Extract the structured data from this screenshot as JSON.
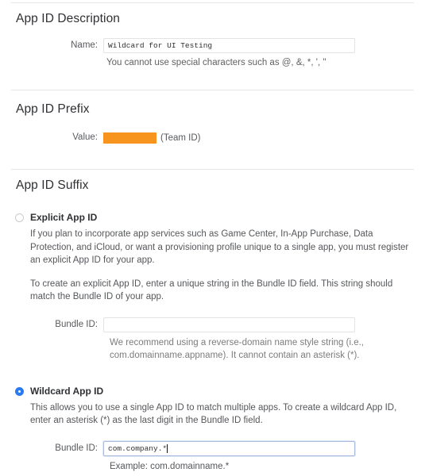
{
  "sections": {
    "description": {
      "title": "App ID Description",
      "name_label": "Name:",
      "name_value": "Wildcard for UI Testing",
      "name_hint": "You cannot use special characters such as @, &, *, ', \""
    },
    "prefix": {
      "title": "App ID Prefix",
      "value_label": "Value:",
      "redacted_value": "",
      "team_id_note": "(Team ID)",
      "redaction_color": "#f7941d"
    },
    "suffix": {
      "title": "App ID Suffix",
      "explicit": {
        "option_label": "Explicit App ID",
        "selected": false,
        "paragraph_1": "If you plan to incorporate app services such as Game Center, In-App Purchase, Data Protection, and iCloud, or want a provisioning profile unique to a single app, you must register an explicit App ID for your app.",
        "paragraph_2": "To create an explicit App ID, enter a unique string in the Bundle ID field. This string should match the Bundle ID of your app.",
        "bundle_label": "Bundle ID:",
        "bundle_value": "",
        "bundle_hint": "We recommend using a reverse-domain name style string (i.e., com.domainname.appname). It cannot contain an asterisk (*)."
      },
      "wildcard": {
        "option_label": "Wildcard App ID",
        "selected": true,
        "paragraph_1": "This allows you to use a single App ID to match multiple apps. To create a wildcard App ID, enter an asterisk (*) as the last digit in the Bundle ID field.",
        "bundle_label": "Bundle ID:",
        "bundle_value": "com.company.*",
        "bundle_hint": "Example: com.domainname.*"
      }
    }
  },
  "colors": {
    "radio_selected": "#2a7af0",
    "redaction": "#f7941d",
    "divider": "#e4e6e8",
    "text_primary": "#2f3033",
    "text_secondary": "#55575a"
  }
}
